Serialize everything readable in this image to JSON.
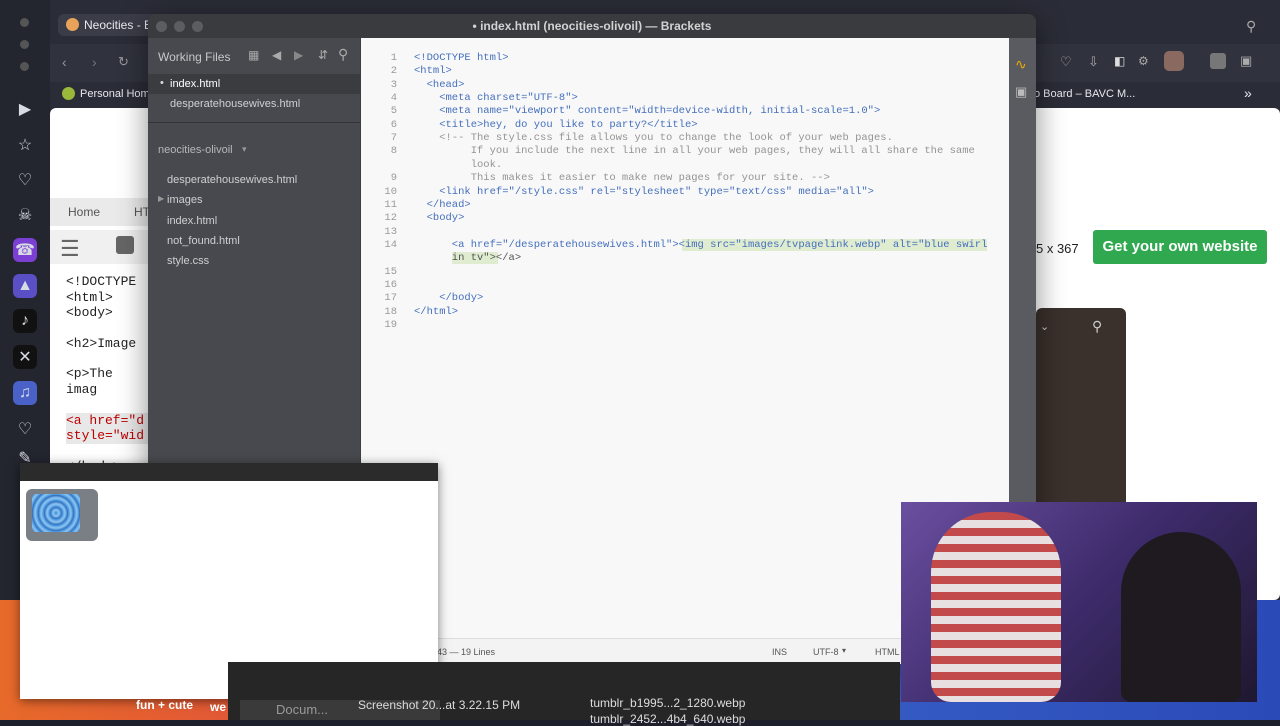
{
  "browser": {
    "tab_title": "Neocities - E",
    "bookmarks": [
      "Personal Home",
      "o Board – BAVC M..."
    ],
    "page": {
      "breadcrumb": [
        "Home",
        "HT"
      ],
      "size_label": "5 x 367",
      "cta": "Get your own website",
      "code_lines": [
        "<!DOCTYPE",
        "<html>",
        "<body>",
        "<h2>Image",
        "<p>The imag",
        "<a href=\"d",
        "style=\"wid",
        "</body>"
      ]
    }
  },
  "brackets": {
    "title": "• index.html (neocities-olivoil) — Brackets",
    "working_files_label": "Working Files",
    "working_files": [
      "index.html",
      "desperatehousewives.html"
    ],
    "project_name": "neocities-olivoil",
    "project_files": [
      "desperatehousewives.html",
      "images",
      "index.html",
      "not_found.html",
      "style.css"
    ],
    "status": {
      "position": "43 — 19 Lines",
      "mode": "INS",
      "encoding": "UTF-8",
      "language": "HTML"
    }
  },
  "code": [
    {
      "n": "1",
      "t": "<!DOCTYPE html>"
    },
    {
      "n": "2",
      "t": "<html>"
    },
    {
      "n": "3",
      "t": "  <head>"
    },
    {
      "n": "4",
      "t": "    <meta charset=\"UTF-8\">"
    },
    {
      "n": "5",
      "t": "    <meta name=\"viewport\" content=\"width=device-width, initial-scale=1.0\">"
    },
    {
      "n": "6",
      "t": "    <title>hey, do you like to party?</title>"
    },
    {
      "n": "7",
      "t": "    <!-- The style.css file allows you to change the look of your web pages."
    },
    {
      "n": "8",
      "t": "         If you include the next line in all your web pages, they will all share the same"
    },
    {
      "n": "",
      "t": "         look."
    },
    {
      "n": "9",
      "t": "         This makes it easier to make new pages for your site. -->"
    },
    {
      "n": "10",
      "t": "    <link href=\"/style.css\" rel=\"stylesheet\" type=\"text/css\" media=\"all\">"
    },
    {
      "n": "11",
      "t": "  </head>"
    },
    {
      "n": "12",
      "t": "  <body>"
    },
    {
      "n": "13",
      "t": ""
    },
    {
      "n": "14",
      "t": "      <a href=\"/desperatehousewives.html\"><img src=\"images/tvpagelink.webp\" alt=\"blue swirl"
    },
    {
      "n": "",
      "t": "      in tv\"></a>"
    },
    {
      "n": "15",
      "t": ""
    },
    {
      "n": "16",
      "t": ""
    },
    {
      "n": "17",
      "t": "    </body>"
    },
    {
      "n": "18",
      "t": "</html>"
    },
    {
      "n": "19",
      "t": ""
    }
  ],
  "taskbar": {
    "label_left": "fun + cute",
    "label_we": "we",
    "items": [
      "Docum...",
      "Screenshot 20...at 3.22.15 PM",
      "tumblr_b1995...2_1280.webp",
      "tumblr_2452...4b4_640.webp"
    ]
  }
}
